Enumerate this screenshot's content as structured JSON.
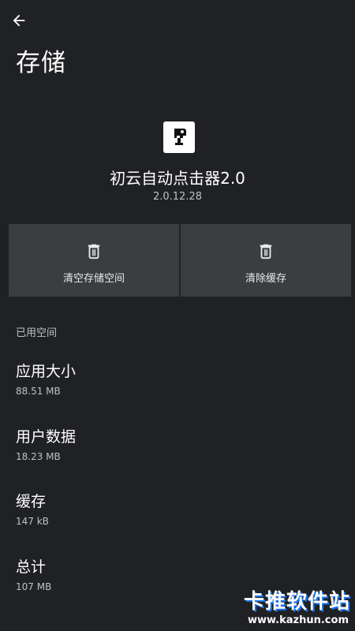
{
  "header": {
    "title": "存储"
  },
  "app": {
    "name": "初云自动点击器2.0",
    "version": "2.0.12.28"
  },
  "actions": [
    {
      "label": "清空存储空间",
      "icon": "trash-icon"
    },
    {
      "label": "清除缓存",
      "icon": "trash-icon"
    }
  ],
  "storage": {
    "section_title": "已用空间",
    "items": [
      {
        "label": "应用大小",
        "value": "88.51 MB"
      },
      {
        "label": "用户数据",
        "value": "18.23 MB"
      },
      {
        "label": "缓存",
        "value": "147 kB"
      },
      {
        "label": "总计",
        "value": "107 MB"
      }
    ]
  },
  "watermark": {
    "text": "卡推软件站",
    "url": "www.kazhun.com"
  },
  "colors": {
    "background": "#202124",
    "button": "#3c3d40",
    "text_primary": "#ffffff",
    "text_secondary": "#bdc1c6"
  }
}
